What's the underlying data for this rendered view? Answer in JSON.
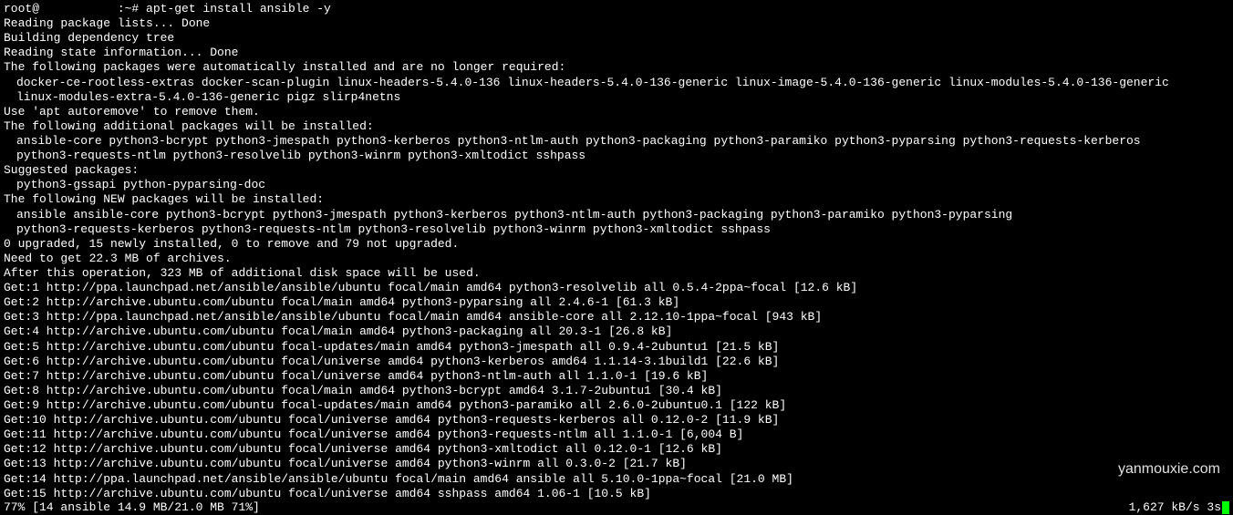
{
  "terminal": {
    "prompt": "root@           :~# apt-get install ansible -y",
    "lines": [
      "Reading package lists... Done",
      "Building dependency tree",
      "Reading state information... Done",
      "The following packages were automatically installed and are no longer required:"
    ],
    "auto_installed": [
      "docker-ce-rootless-extras docker-scan-plugin linux-headers-5.4.0-136 linux-headers-5.4.0-136-generic linux-image-5.4.0-136-generic linux-modules-5.4.0-136-generic",
      "linux-modules-extra-5.4.0-136-generic pigz slirp4netns"
    ],
    "autoremove": "Use 'apt autoremove' to remove them.",
    "additional_header": "The following additional packages will be installed:",
    "additional_packages": [
      "ansible-core python3-bcrypt python3-jmespath python3-kerberos python3-ntlm-auth python3-packaging python3-paramiko python3-pyparsing python3-requests-kerberos",
      "python3-requests-ntlm python3-resolvelib python3-winrm python3-xmltodict sshpass"
    ],
    "suggested_header": "Suggested packages:",
    "suggested_packages": [
      "python3-gssapi python-pyparsing-doc"
    ],
    "new_header": "The following NEW packages will be installed:",
    "new_packages": [
      "ansible ansible-core python3-bcrypt python3-jmespath python3-kerberos python3-ntlm-auth python3-packaging python3-paramiko python3-pyparsing",
      "python3-requests-kerberos python3-requests-ntlm python3-resolvelib python3-winrm python3-xmltodict sshpass"
    ],
    "summary": [
      "0 upgraded, 15 newly installed, 0 to remove and 79 not upgraded.",
      "Need to get 22.3 MB of archives.",
      "After this operation, 323 MB of additional disk space will be used."
    ],
    "downloads": [
      "Get:1 http://ppa.launchpad.net/ansible/ansible/ubuntu focal/main amd64 python3-resolvelib all 0.5.4-2ppa~focal [12.6 kB]",
      "Get:2 http://archive.ubuntu.com/ubuntu focal/main amd64 python3-pyparsing all 2.4.6-1 [61.3 kB]",
      "Get:3 http://ppa.launchpad.net/ansible/ansible/ubuntu focal/main amd64 ansible-core all 2.12.10-1ppa~focal [943 kB]",
      "Get:4 http://archive.ubuntu.com/ubuntu focal/main amd64 python3-packaging all 20.3-1 [26.8 kB]",
      "Get:5 http://archive.ubuntu.com/ubuntu focal-updates/main amd64 python3-jmespath all 0.9.4-2ubuntu1 [21.5 kB]",
      "Get:6 http://archive.ubuntu.com/ubuntu focal/universe amd64 python3-kerberos amd64 1.1.14-3.1build1 [22.6 kB]",
      "Get:7 http://archive.ubuntu.com/ubuntu focal/universe amd64 python3-ntlm-auth all 1.1.0-1 [19.6 kB]",
      "Get:8 http://archive.ubuntu.com/ubuntu focal/main amd64 python3-bcrypt amd64 3.1.7-2ubuntu1 [30.4 kB]",
      "Get:9 http://archive.ubuntu.com/ubuntu focal-updates/main amd64 python3-paramiko all 2.6.0-2ubuntu0.1 [122 kB]",
      "Get:10 http://archive.ubuntu.com/ubuntu focal/universe amd64 python3-requests-kerberos all 0.12.0-2 [11.9 kB]",
      "Get:11 http://archive.ubuntu.com/ubuntu focal/universe amd64 python3-requests-ntlm all 1.1.0-1 [6,004 B]",
      "Get:12 http://archive.ubuntu.com/ubuntu focal/universe amd64 python3-xmltodict all 0.12.0-1 [12.6 kB]",
      "Get:13 http://archive.ubuntu.com/ubuntu focal/universe amd64 python3-winrm all 0.3.0-2 [21.7 kB]",
      "Get:14 http://ppa.launchpad.net/ansible/ansible/ubuntu focal/main amd64 ansible all 5.10.0-1ppa~focal [21.0 MB]",
      "Get:15 http://archive.ubuntu.com/ubuntu focal/universe amd64 sshpass amd64 1.06-1 [10.5 kB]"
    ],
    "progress_left": "77% [14 ansible 14.9 MB/21.0 MB 71%]",
    "progress_right": "1,627 kB/s 3s"
  },
  "watermark": "yanmouxie.com"
}
